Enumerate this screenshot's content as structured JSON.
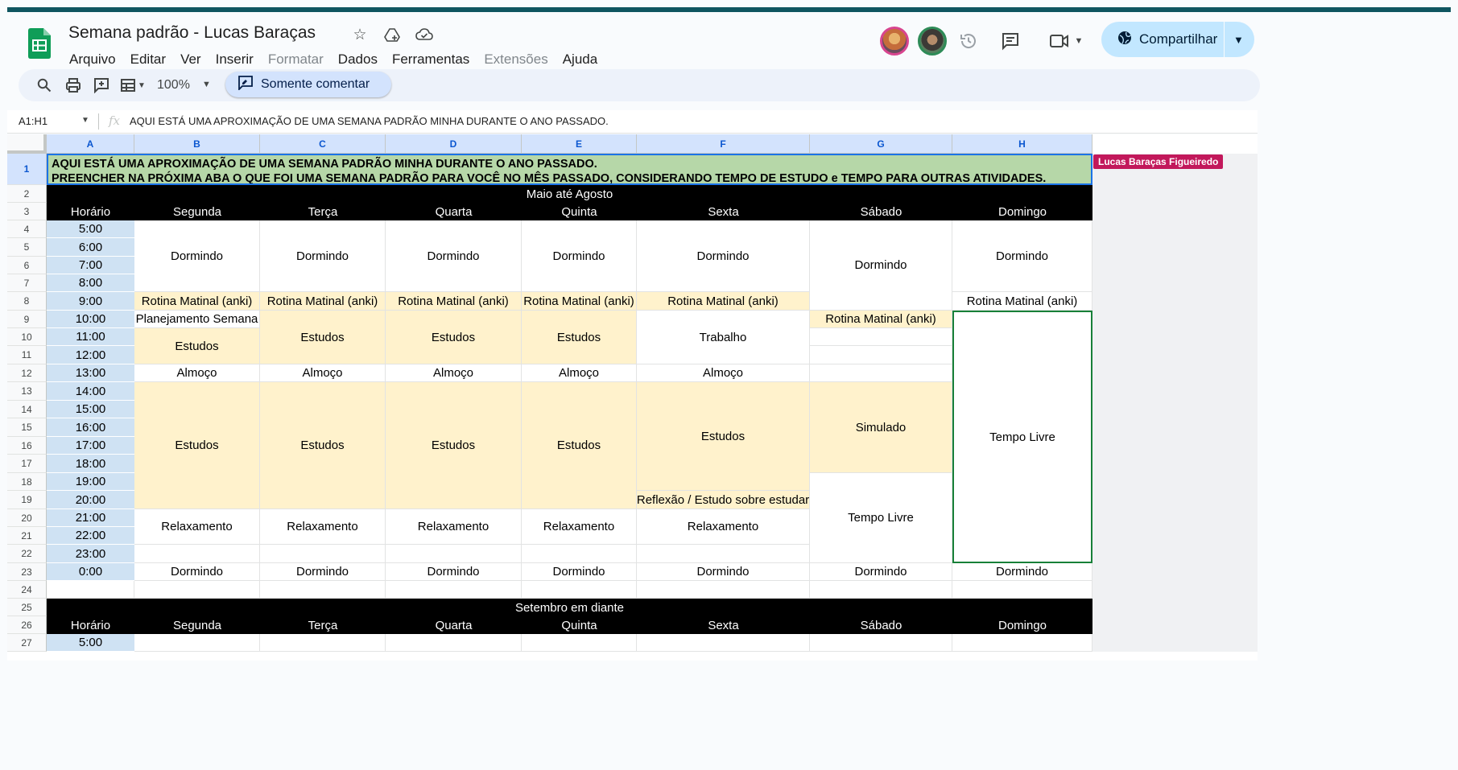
{
  "app": {
    "doc_title": "Semana padrão - Lucas Baraças",
    "menu": [
      {
        "label": "Arquivo",
        "disabled": false
      },
      {
        "label": "Editar",
        "disabled": false
      },
      {
        "label": "Ver",
        "disabled": false
      },
      {
        "label": "Inserir",
        "disabled": false
      },
      {
        "label": "Formatar",
        "disabled": true
      },
      {
        "label": "Dados",
        "disabled": false
      },
      {
        "label": "Ferramentas",
        "disabled": false
      },
      {
        "label": "Extensões",
        "disabled": true
      },
      {
        "label": "Ajuda",
        "disabled": false
      }
    ],
    "share_label": "Compartilhar",
    "zoom": "100%",
    "comment_mode_label": "Somente comentar",
    "accent_color": "#0b57d0",
    "brand_color": "#0f9d58"
  },
  "formula_bar": {
    "name_box": "A1:H1",
    "content": "AQUI ESTÁ UMA APROXIMAÇÃO DE UMA SEMANA PADRÃO MINHA DURANTE O ANO PASSADO."
  },
  "columns": [
    "A",
    "B",
    "C",
    "D",
    "E",
    "F",
    "G",
    "H"
  ],
  "rows": [
    "1",
    "2",
    "3",
    "4",
    "5",
    "6",
    "7",
    "8",
    "9",
    "10",
    "11",
    "12",
    "13",
    "14",
    "15",
    "16",
    "17",
    "18",
    "19",
    "20",
    "21",
    "22",
    "23",
    "24",
    "25",
    "26",
    "27"
  ],
  "collaborator_tag": "Lucas Baraças Figueiredo",
  "sheet": {
    "banner_line1": "AQUI ESTÁ UMA APROXIMAÇÃO DE UMA SEMANA PADRÃO MINHA DURANTE O ANO PASSADO.",
    "banner_line2": "PREENCHER NA PRÓXIMA ABA O QUE FOI UMA SEMANA PADRÃO PARA VOCÊ NO MÊS PASSADO, CONSIDERANDO TEMPO DE ESTUDO e TEMPO PARA OUTRAS ATIVIDADES.",
    "period1_title": "Maio até Agosto",
    "period2_title": "Setembro em diante",
    "headers": [
      "Horário",
      "Segunda",
      "Terça",
      "Quarta",
      "Quinta",
      "Sexta",
      "Sábado",
      "Domingo"
    ],
    "times": [
      "5:00",
      "6:00",
      "7:00",
      "8:00",
      "9:00",
      "10:00",
      "11:00",
      "12:00",
      "13:00",
      "14:00",
      "15:00",
      "16:00",
      "17:00",
      "18:00",
      "19:00",
      "20:00",
      "21:00",
      "22:00",
      "23:00",
      "0:00"
    ],
    "times_period2": [
      "5:00"
    ],
    "blocks": [
      {
        "col": 1,
        "r0": 0,
        "r1": 3,
        "text": "Dormindo",
        "style": "white"
      },
      {
        "col": 2,
        "r0": 0,
        "r1": 3,
        "text": "Dormindo",
        "style": "white"
      },
      {
        "col": 3,
        "r0": 0,
        "r1": 3,
        "text": "Dormindo",
        "style": "white"
      },
      {
        "col": 4,
        "r0": 0,
        "r1": 3,
        "text": "Dormindo",
        "style": "white"
      },
      {
        "col": 5,
        "r0": 0,
        "r1": 3,
        "text": "Dormindo",
        "style": "white"
      },
      {
        "col": 6,
        "r0": 0,
        "r1": 4,
        "text": "Dormindo",
        "style": "white"
      },
      {
        "col": 7,
        "r0": 0,
        "r1": 3,
        "text": "Dormindo",
        "style": "white"
      },
      {
        "col": 1,
        "r0": 4,
        "r1": 4,
        "text": "Rotina Matinal (anki)",
        "style": "tan"
      },
      {
        "col": 2,
        "r0": 4,
        "r1": 4,
        "text": "Rotina Matinal (anki)",
        "style": "tan"
      },
      {
        "col": 3,
        "r0": 4,
        "r1": 4,
        "text": "Rotina Matinal (anki)",
        "style": "tan"
      },
      {
        "col": 4,
        "r0": 4,
        "r1": 4,
        "text": "Rotina Matinal (anki)",
        "style": "tan"
      },
      {
        "col": 5,
        "r0": 4,
        "r1": 4,
        "text": "Rotina Matinal (anki)",
        "style": "tan"
      },
      {
        "col": 7,
        "r0": 4,
        "r1": 4,
        "text": "Rotina Matinal (anki)",
        "style": "white"
      },
      {
        "col": 1,
        "r0": 5,
        "r1": 5,
        "text": "Planejamento Semana",
        "style": "white"
      },
      {
        "col": 1,
        "r0": 6,
        "r1": 7,
        "text": "Estudos",
        "style": "tan"
      },
      {
        "col": 2,
        "r0": 5,
        "r1": 7,
        "text": "Estudos",
        "style": "tan"
      },
      {
        "col": 3,
        "r0": 5,
        "r1": 7,
        "text": "Estudos",
        "style": "tan"
      },
      {
        "col": 4,
        "r0": 5,
        "r1": 7,
        "text": "Estudos",
        "style": "tan"
      },
      {
        "col": 5,
        "r0": 5,
        "r1": 7,
        "text": "Trabalho",
        "style": "white"
      },
      {
        "col": 6,
        "r0": 5,
        "r1": 5,
        "text": "Rotina Matinal (anki)",
        "style": "tan"
      },
      {
        "col": 6,
        "r0": 6,
        "r1": 6,
        "text": "",
        "style": "white"
      },
      {
        "col": 6,
        "r0": 7,
        "r1": 7,
        "text": "",
        "style": "white"
      },
      {
        "col": 7,
        "r0": 5,
        "r1": 18,
        "text": "Tempo Livre",
        "style": "white",
        "selected": true
      },
      {
        "col": 1,
        "r0": 8,
        "r1": 8,
        "text": "Almoço",
        "style": "white"
      },
      {
        "col": 2,
        "r0": 8,
        "r1": 8,
        "text": "Almoço",
        "style": "white"
      },
      {
        "col": 3,
        "r0": 8,
        "r1": 8,
        "text": "Almoço",
        "style": "white"
      },
      {
        "col": 4,
        "r0": 8,
        "r1": 8,
        "text": "Almoço",
        "style": "white"
      },
      {
        "col": 5,
        "r0": 8,
        "r1": 8,
        "text": "Almoço",
        "style": "white"
      },
      {
        "col": 6,
        "r0": 8,
        "r1": 8,
        "text": "",
        "style": "white"
      },
      {
        "col": 1,
        "r0": 9,
        "r1": 15,
        "text": "Estudos",
        "style": "tan"
      },
      {
        "col": 2,
        "r0": 9,
        "r1": 15,
        "text": "Estudos",
        "style": "tan"
      },
      {
        "col": 3,
        "r0": 9,
        "r1": 15,
        "text": "Estudos",
        "style": "tan"
      },
      {
        "col": 4,
        "r0": 9,
        "r1": 15,
        "text": "Estudos",
        "style": "tan"
      },
      {
        "col": 5,
        "r0": 9,
        "r1": 14,
        "text": "Estudos",
        "style": "tan"
      },
      {
        "col": 5,
        "r0": 15,
        "r1": 15,
        "text": "Reflexão / Estudo sobre estudar",
        "style": "tan"
      },
      {
        "col": 6,
        "r0": 9,
        "r1": 13,
        "text": "Simulado",
        "style": "tan"
      },
      {
        "col": 6,
        "r0": 14,
        "r1": 18,
        "text": "Tempo Livre",
        "style": "white"
      },
      {
        "col": 1,
        "r0": 16,
        "r1": 17,
        "text": "Relaxamento",
        "style": "white"
      },
      {
        "col": 2,
        "r0": 16,
        "r1": 17,
        "text": "Relaxamento",
        "style": "white"
      },
      {
        "col": 3,
        "r0": 16,
        "r1": 17,
        "text": "Relaxamento",
        "style": "white"
      },
      {
        "col": 4,
        "r0": 16,
        "r1": 17,
        "text": "Relaxamento",
        "style": "white"
      },
      {
        "col": 5,
        "r0": 16,
        "r1": 17,
        "text": "Relaxamento",
        "style": "white"
      },
      {
        "col": 1,
        "r0": 18,
        "r1": 18,
        "text": "",
        "style": "white"
      },
      {
        "col": 2,
        "r0": 18,
        "r1": 18,
        "text": "",
        "style": "white"
      },
      {
        "col": 3,
        "r0": 18,
        "r1": 18,
        "text": "",
        "style": "white"
      },
      {
        "col": 4,
        "r0": 18,
        "r1": 18,
        "text": "",
        "style": "white"
      },
      {
        "col": 5,
        "r0": 18,
        "r1": 18,
        "text": "",
        "style": "white"
      },
      {
        "col": 1,
        "r0": 19,
        "r1": 19,
        "text": "Dormindo",
        "style": "white"
      },
      {
        "col": 2,
        "r0": 19,
        "r1": 19,
        "text": "Dormindo",
        "style": "white"
      },
      {
        "col": 3,
        "r0": 19,
        "r1": 19,
        "text": "Dormindo",
        "style": "white"
      },
      {
        "col": 4,
        "r0": 19,
        "r1": 19,
        "text": "Dormindo",
        "style": "white"
      },
      {
        "col": 5,
        "r0": 19,
        "r1": 19,
        "text": "Dormindo",
        "style": "white"
      },
      {
        "col": 6,
        "r0": 19,
        "r1": 19,
        "text": "Dormindo",
        "style": "white"
      },
      {
        "col": 7,
        "r0": 19,
        "r1": 19,
        "text": "Dormindo",
        "style": "white"
      }
    ]
  }
}
